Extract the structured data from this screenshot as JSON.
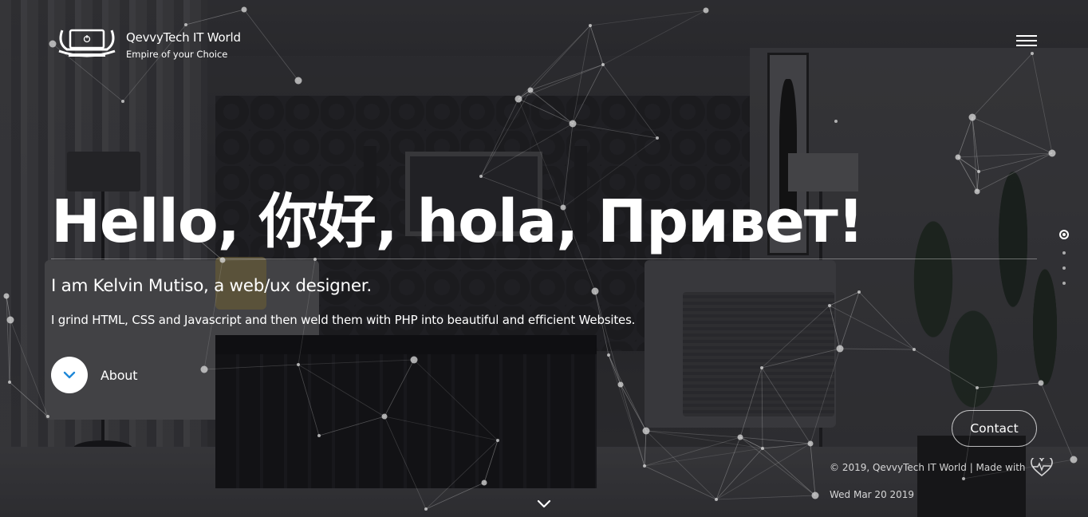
{
  "brand": {
    "name": "QevvyTech IT World",
    "tagline": "Empire of your Choice",
    "logo_icon": "laptop-power-icon"
  },
  "nav": {
    "menu_icon": "hamburger-menu-icon"
  },
  "hero": {
    "title": "Hello, 你好, hola, Привет!",
    "intro": "I am Kelvin Mutiso, a web/ux designer.",
    "description": "I grind HTML, CSS and Javascript and then weld them with PHP into beautiful and efficient Websites.",
    "about_label": "About",
    "about_icon": "chevron-down-icon"
  },
  "section_dots": {
    "count": 4,
    "active_index": 0
  },
  "contact": {
    "label": "Contact"
  },
  "footer": {
    "copyright": "© 2019, QevvyTech IT World | Made with",
    "heart_icon": "heartbeat-icon",
    "date": "Wed Mar 20 2019"
  },
  "scroll": {
    "icon": "chevron-down-icon"
  },
  "colors": {
    "accent": "#1e88d8",
    "text": "#ffffff"
  }
}
